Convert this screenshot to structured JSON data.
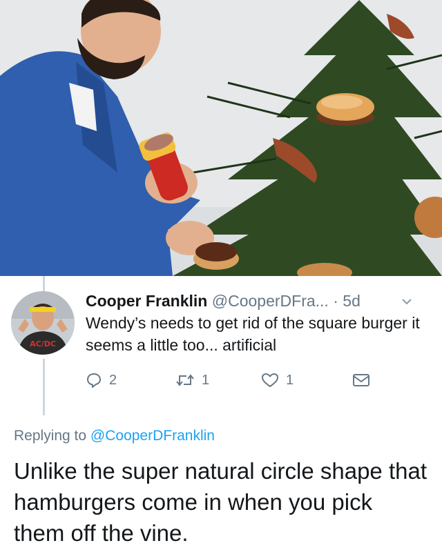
{
  "tweet": {
    "display_name": "Cooper Franklin",
    "handle": "@CooperDFra...",
    "separator": "·",
    "time": "5d",
    "text": "Wendy’s needs to get rid of the square burger it seems a little too... artificial",
    "avatar_shirt_text": "AC/DC",
    "actions": {
      "reply": {
        "icon": "reply-icon",
        "count": "2"
      },
      "retweet": {
        "icon": "retweet-icon",
        "count": "1"
      },
      "like": {
        "icon": "heart-icon",
        "count": "1"
      },
      "message": {
        "icon": "envelope-icon"
      }
    }
  },
  "reply": {
    "replying_prefix": "Replying to",
    "replying_to": "@CooperDFranklin",
    "text": "Unlike the super natural circle shape that hamburgers come in when you pick them off the vine."
  },
  "colors": {
    "text": "#14171a",
    "secondary": "#657786",
    "link": "#1da1f2",
    "thread_line": "#ccd6dd"
  }
}
